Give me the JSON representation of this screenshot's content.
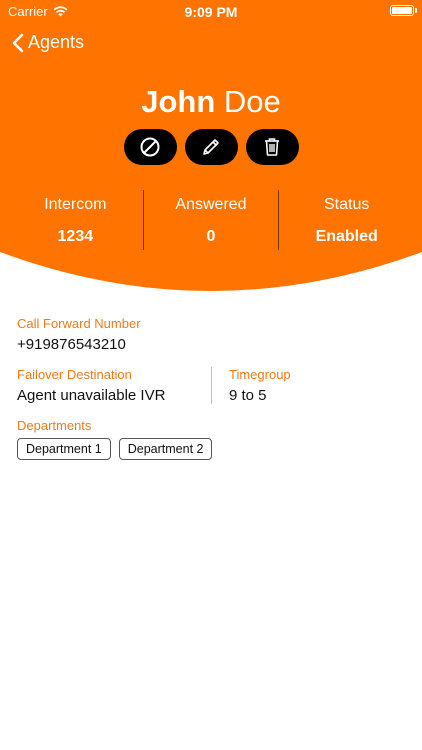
{
  "status_bar": {
    "carrier": "Carrier",
    "time": "9:09 PM"
  },
  "nav": {
    "back_label": "Agents"
  },
  "agent": {
    "first_name": "John",
    "last_name": "Doe"
  },
  "actions": {
    "block_icon": "block-icon",
    "edit_icon": "pencil-icon",
    "delete_icon": "trash-icon"
  },
  "stats": [
    {
      "label": "Intercom",
      "value": "1234"
    },
    {
      "label": "Answered",
      "value": "0"
    },
    {
      "label": "Status",
      "value": "Enabled"
    }
  ],
  "details": {
    "call_forward_label": "Call Forward Number",
    "call_forward_value": "+919876543210",
    "failover_label": "Failover Destination",
    "failover_value": "Agent unavailable IVR",
    "timegroup_label": "Timegroup",
    "timegroup_value": "9 to 5",
    "departments_label": "Departments",
    "departments": [
      "Department 1",
      "Department 2"
    ]
  },
  "colors": {
    "accent": "#ff7300",
    "label_orange": "#f07a1a",
    "button_black": "#000000"
  }
}
